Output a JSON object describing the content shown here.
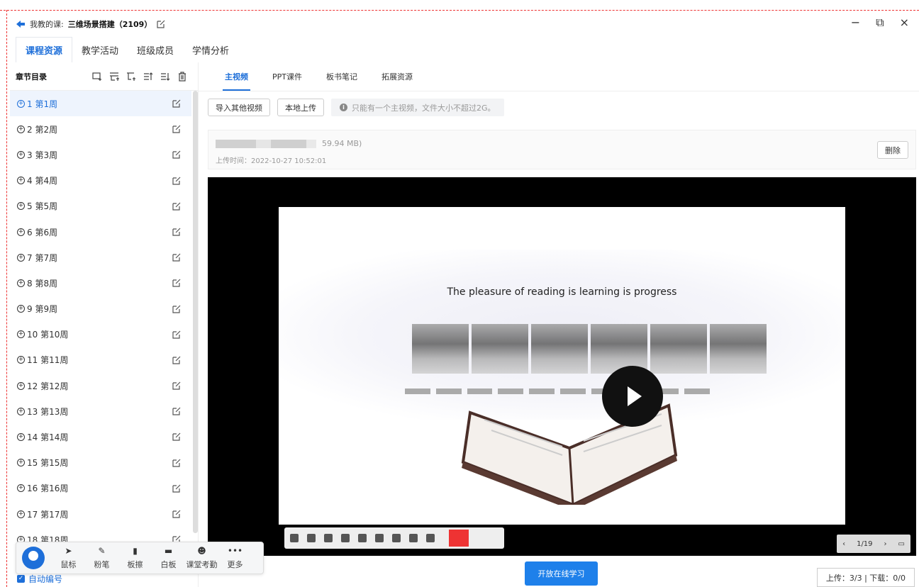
{
  "titlebar": {
    "course_label": "我教的课:",
    "course_name": "三维场景搭建（2109）"
  },
  "window_controls": {
    "minimize": "−",
    "restore": "⧉",
    "close": "×"
  },
  "topnav": {
    "tabs": [
      "课程资源",
      "教学活动",
      "班级成员",
      "学情分析"
    ]
  },
  "sidebar": {
    "title": "章节目录",
    "chapters": [
      "1 第1周",
      "2 第2周",
      "3 第3周",
      "4 第4周",
      "5 第5周",
      "6 第6周",
      "7 第7周",
      "8 第8周",
      "9 第9周",
      "10 第10周",
      "11 第11周",
      "12 第12周",
      "13 第13周",
      "14 第14周",
      "15 第15周",
      "16 第16周",
      "17 第17周",
      "18 第18周"
    ],
    "auto_number": "自动编号"
  },
  "subtabs": [
    "主视频",
    "PPT课件",
    "板书笔记",
    "拓展资源"
  ],
  "actions": {
    "import_btn": "导入其他视频",
    "upload_btn": "本地上传",
    "hint": "只能有一个主视频，文件大小不超过2G。"
  },
  "file": {
    "size": "59.94 MB)",
    "upload_time": "上传时间：2022-10-27 10:52:01",
    "delete_btn": "删除"
  },
  "video": {
    "quote": "The pleasure of reading is learning is progress",
    "page_indicator": "1/19"
  },
  "floatbar": {
    "items": [
      "鼠标",
      "粉笔",
      "板擦",
      "白板",
      "课堂考勤",
      "更多"
    ]
  },
  "open_btn": "开放在线学习",
  "transfer": "上传：3/3 | 下载：0/0",
  "colors": {
    "accent": "#1e6fd9",
    "button_blue": "#1e80ea",
    "dashed_border": "#ee3333"
  }
}
